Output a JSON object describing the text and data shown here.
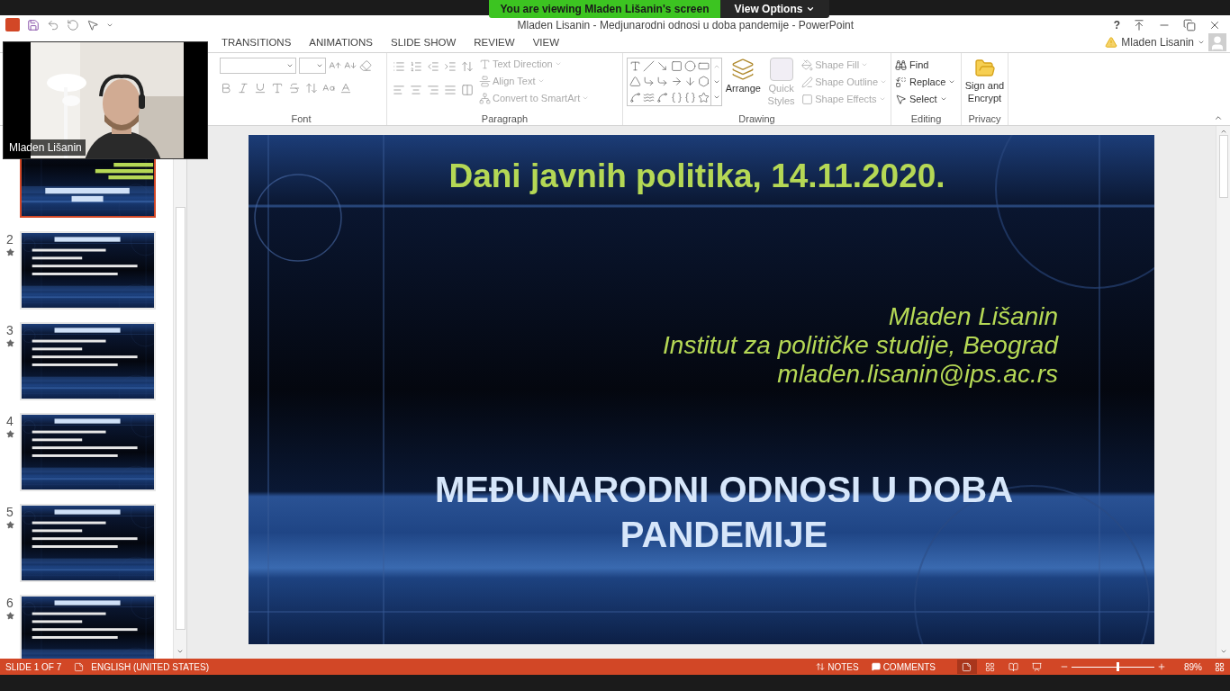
{
  "share_banner": {
    "message": "You are viewing Mladen Lišanin's screen",
    "options_label": "View Options"
  },
  "window": {
    "title": "Mladen Lisanin - Medjunarodni odnosi u doba pandemije - PowerPoint",
    "help_label": "?",
    "account": "Mladen Lisanin"
  },
  "tabs": [
    {
      "label": "TRANSITIONS",
      "selected": false
    },
    {
      "label": "ANIMATIONS",
      "selected": false
    },
    {
      "label": "SLIDE SHOW",
      "selected": false
    },
    {
      "label": "REVIEW",
      "selected": false
    },
    {
      "label": "VIEW",
      "selected": false
    }
  ],
  "ribbon": {
    "font": {
      "label": "Font"
    },
    "paragraph": {
      "label": "Paragraph",
      "commands": [
        {
          "label": "Text Direction",
          "disabled": true
        },
        {
          "label": "Align Text",
          "disabled": true
        },
        {
          "label": "Convert to SmartArt",
          "disabled": true
        }
      ]
    },
    "drawing": {
      "label": "Drawing",
      "large": [
        {
          "label": "Arrange",
          "disabled": false
        },
        {
          "label": "Quick Styles",
          "disabled": true
        }
      ],
      "commands": [
        {
          "label": "Shape Fill",
          "disabled": true
        },
        {
          "label": "Shape Outline",
          "disabled": true
        },
        {
          "label": "Shape Effects",
          "disabled": true
        }
      ]
    },
    "editing": {
      "label": "Editing",
      "commands": [
        {
          "label": "Find",
          "kind": "find"
        },
        {
          "label": "Replace",
          "kind": "replace"
        },
        {
          "label": "Select",
          "kind": "select"
        }
      ]
    },
    "privacy": {
      "label": "Privacy",
      "command": "Sign and Encrypt"
    }
  },
  "thumbnails": [
    {
      "selected": true,
      "kind": "title"
    },
    {
      "number": "2",
      "selected": false,
      "animated": true,
      "kind": "content"
    },
    {
      "number": "3",
      "selected": false,
      "animated": true,
      "kind": "content"
    },
    {
      "number": "4",
      "selected": false,
      "animated": true,
      "kind": "content"
    },
    {
      "number": "5",
      "selected": false,
      "animated": true,
      "kind": "content"
    },
    {
      "number": "6",
      "selected": false,
      "animated": true,
      "kind": "content"
    }
  ],
  "slide": {
    "event": "Dani javnih politika, 14.11.2020.",
    "author_lines": [
      "Mladen Lišanin",
      "Institut za političke studije, Beograd",
      "mladen.lisanin@ips.ac.rs"
    ],
    "title": "MEĐUNARODNI ODNOSI U DOBA PANDEMIJE"
  },
  "status_bar": {
    "slide_indicator": "SLIDE 1 OF 7",
    "language": "ENGLISH (UNITED STATES)",
    "notes": "NOTES",
    "comments": "COMMENTS",
    "views": [
      {
        "kind": "normal",
        "selected": true
      },
      {
        "kind": "sorter",
        "selected": false
      },
      {
        "kind": "reading",
        "selected": false
      },
      {
        "kind": "slideshow",
        "selected": false
      }
    ],
    "zoom": {
      "level": 0.55,
      "reading": "89%"
    }
  },
  "video": {
    "name": "Mladen Lišanin"
  }
}
